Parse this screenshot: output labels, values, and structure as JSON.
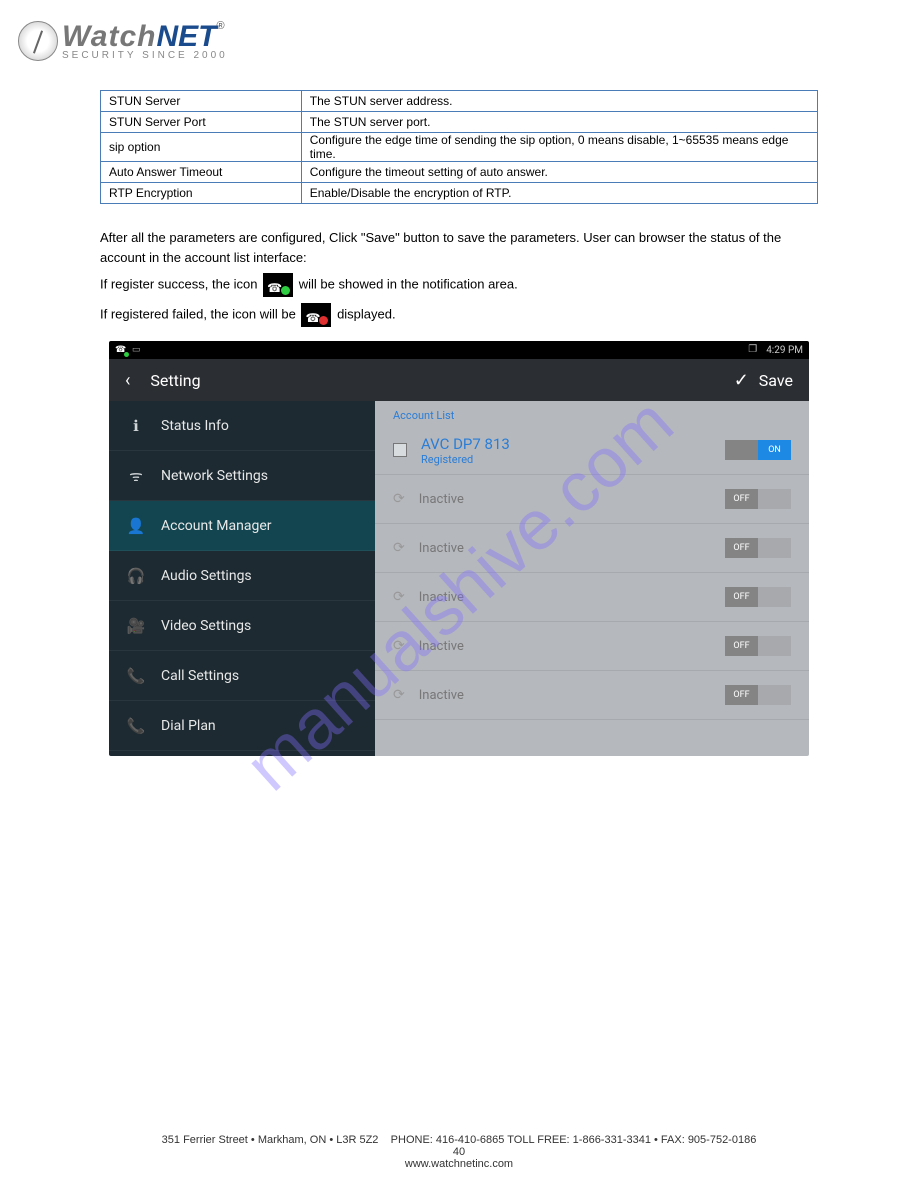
{
  "logo": {
    "watch": "Watch",
    "net": "NET",
    "reg": "®",
    "sub": "SECURITY SINCE 2000"
  },
  "table_rows": [
    {
      "label": "STUN Server",
      "desc": "The STUN server address."
    },
    {
      "label": "STUN Server Port",
      "desc": "The STUN server port."
    },
    {
      "label": "sip option",
      "desc": "Configure the edge time of sending the sip option, 0 means disable, 1~65535 means edge time."
    },
    {
      "label": "Auto Answer Timeout",
      "desc": "Configure the timeout setting of auto answer."
    },
    {
      "label": "RTP Encryption",
      "desc": "Enable/Disable the encryption of RTP."
    }
  ],
  "body_text": {
    "line1": "After all the parameters are configured, Click \"Save\" button to save the parameters. User can browser the status of the account in the account list interface:",
    "line2_pre": "If register success, the icon ",
    "line2_post": " will be showed in the notification area.",
    "line3_pre": "If registered failed, the icon will be ",
    "line3_post": " displayed."
  },
  "status_bar": {
    "time": "4:29 PM"
  },
  "titlebar": {
    "title": "Setting",
    "save": "Save"
  },
  "sidebar": [
    {
      "icon": "info-icon",
      "label": "Status Info"
    },
    {
      "icon": "antenna-icon",
      "label": "Network Settings"
    },
    {
      "icon": "person-icon",
      "label": "Account Manager",
      "active": true
    },
    {
      "icon": "headset-icon",
      "label": "Audio Settings"
    },
    {
      "icon": "camera-icon",
      "label": "Video Settings"
    },
    {
      "icon": "phone-icon",
      "label": "Call Settings"
    },
    {
      "icon": "phone-icon",
      "label": "Dial Plan"
    }
  ],
  "account_list": {
    "header": "Account List",
    "registered": {
      "name": "AVC DP7 813",
      "status": "Registered",
      "toggle": "ON"
    },
    "inactive_label": "Inactive",
    "off_label": "OFF"
  },
  "watermark": "manualshive.com",
  "footer": {
    "left": "351 Ferrier Street • Markham, ON • L3R 5Z2",
    "right": "PHONE: 416-410-6865 TOLL FREE: 1-866-331-3341 • FAX: 905-752-0186",
    "copy": "40",
    "site": "www.watchnetinc.com"
  }
}
